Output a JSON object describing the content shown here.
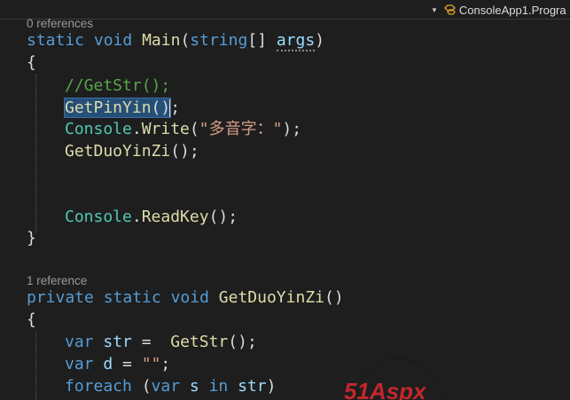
{
  "toolbar": {
    "navigation_dropdown": "ConsoleApp1.Progra"
  },
  "codelens": {
    "main_refs": "0 references",
    "getduoyinzi_refs": "1 reference"
  },
  "code": {
    "main_sig": {
      "kw1": "static",
      "kw2": "void",
      "name": "Main",
      "open": "(",
      "type": "string",
      "arr": "[] ",
      "param": "args",
      "close": ")"
    },
    "brace_open": "{",
    "comment": "//GetStr();",
    "getpinyin": {
      "name": "GetPinYin",
      "parens": "()",
      "semi": ";"
    },
    "write": {
      "cls": "Console",
      "dot": ".",
      "method": "Write",
      "open": "(",
      "str": "\"多音字：\"",
      "close": ");"
    },
    "getduoyinzi_call": {
      "name": "GetDuoYinZi",
      "rest": "();"
    },
    "readkey": {
      "cls": "Console",
      "dot": ".",
      "method": "ReadKey",
      "rest": "();"
    },
    "brace_close": "}",
    "duo_sig": {
      "kw1": "private",
      "kw2": "static",
      "kw3": "void",
      "name": "GetDuoYinZi",
      "rest": "()"
    },
    "brace_open2": "{",
    "var_str": {
      "kw": "var",
      "name": "str",
      "eq": " =  ",
      "fn": "GetStr",
      "rest": "();"
    },
    "var_d": {
      "kw": "var",
      "name": "d",
      "eq": " = ",
      "str": "\"\"",
      "semi": ";"
    },
    "foreach": {
      "kw": "foreach",
      "open": " (",
      "kw2": "var",
      "name": "s",
      "kw3": "in",
      "coll": "str",
      "close": ")"
    }
  },
  "watermark": {
    "text": "51Aspx",
    "color": "#c0282c"
  },
  "theme": {
    "background": "#1e1e1e",
    "keyword": "#569cd6",
    "method": "#dcdcaa",
    "type": "#4ec9b0",
    "comment": "#57a64a",
    "string": "#d69d85",
    "parameter": "#9cdcfe",
    "selection": "#264f78"
  }
}
